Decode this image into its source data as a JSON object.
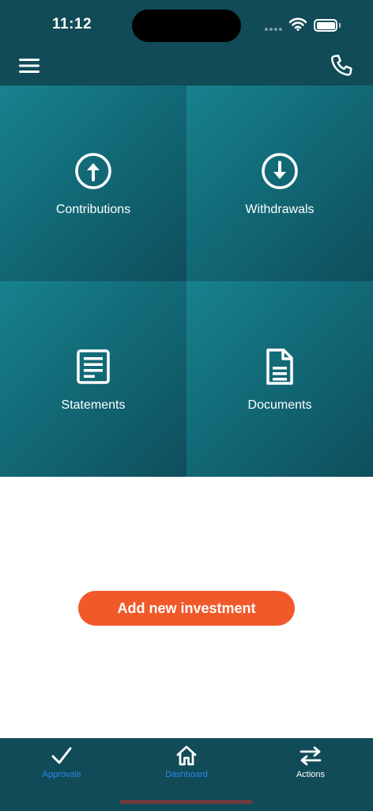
{
  "status_bar": {
    "time": "11:12"
  },
  "tiles": [
    {
      "label": "Contributions",
      "icon": "arrow-up-circle-icon"
    },
    {
      "label": "Withdrawals",
      "icon": "arrow-down-circle-icon"
    },
    {
      "label": "Statements",
      "icon": "statement-icon"
    },
    {
      "label": "Documents",
      "icon": "document-icon"
    }
  ],
  "add_button": {
    "label": "Add new investment"
  },
  "tabs": [
    {
      "label": "Approvals",
      "icon": "check-icon",
      "color": "#2f86ef"
    },
    {
      "label": "Dashboard",
      "icon": "home-icon",
      "color": "#2f86ef"
    },
    {
      "label": "Actions",
      "icon": "swap-arrows-icon",
      "color": "#ffffff"
    }
  ],
  "colors": {
    "header_bg": "#104b57",
    "tile_bg": "#126a77",
    "accent_orange": "#f1592a",
    "tab_active_blue": "#2f86ef"
  }
}
